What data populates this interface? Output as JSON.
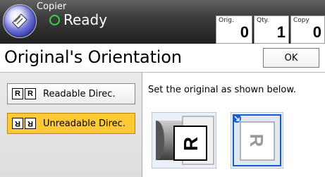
{
  "header": {
    "app_title": "Copier",
    "status_text": "Ready",
    "counters": [
      {
        "label": "Orig.",
        "value": "0"
      },
      {
        "label": "Qty.",
        "value": "1"
      },
      {
        "label": "Copy",
        "value": "0"
      }
    ]
  },
  "page": {
    "title": "Original's Orientation",
    "ok_label": "OK"
  },
  "options": {
    "readable_label": "Readable Direc.",
    "unreadable_label": "Unreadable Direc.",
    "selected": "unreadable",
    "selected_color": "#ffc933"
  },
  "instruction": "Set the original as shown below.",
  "illustration": {
    "letter": "R"
  }
}
